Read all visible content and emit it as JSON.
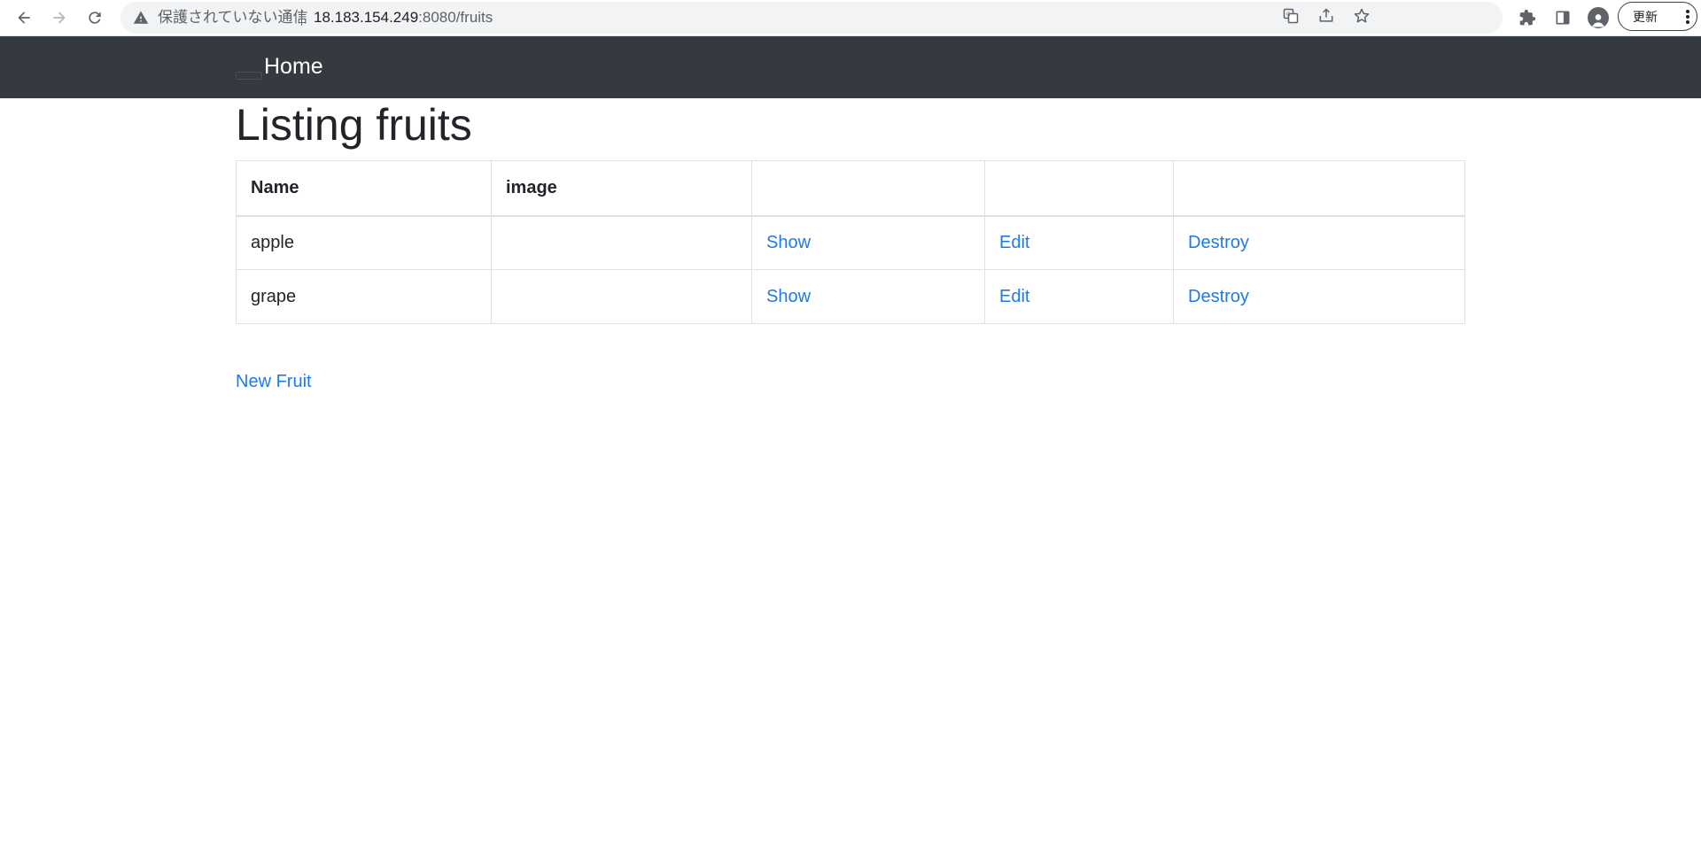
{
  "browser": {
    "security_label": "保護されていない通信",
    "url_host": "18.183.154.249",
    "url_path": ":8080/fruits",
    "update_label": "更新"
  },
  "navbar": {
    "brand": "Home"
  },
  "page": {
    "title": "Listing fruits",
    "table": {
      "headers": [
        "Name",
        "image",
        "",
        "",
        ""
      ],
      "rows": [
        {
          "name": "apple",
          "image": "",
          "show": "Show",
          "edit": "Edit",
          "destroy": "Destroy"
        },
        {
          "name": "grape",
          "image": "",
          "show": "Show",
          "edit": "Edit",
          "destroy": "Destroy"
        }
      ]
    },
    "new_link": "New Fruit"
  },
  "colors": {
    "navbar_bg": "#343a40",
    "link": "#1e7ae6",
    "text": "#212529",
    "border": "#dee2e6"
  },
  "icons": {
    "back": "arrow-left-icon",
    "forward": "arrow-right-icon",
    "reload": "reload-icon",
    "warning": "warning-triangle-icon",
    "translate": "translate-icon",
    "share": "share-icon",
    "bookmark": "star-icon",
    "extensions": "puzzle-icon",
    "side_panel": "side-panel-icon",
    "profile": "profile-avatar-icon",
    "menu": "kebab-menu-icon"
  }
}
